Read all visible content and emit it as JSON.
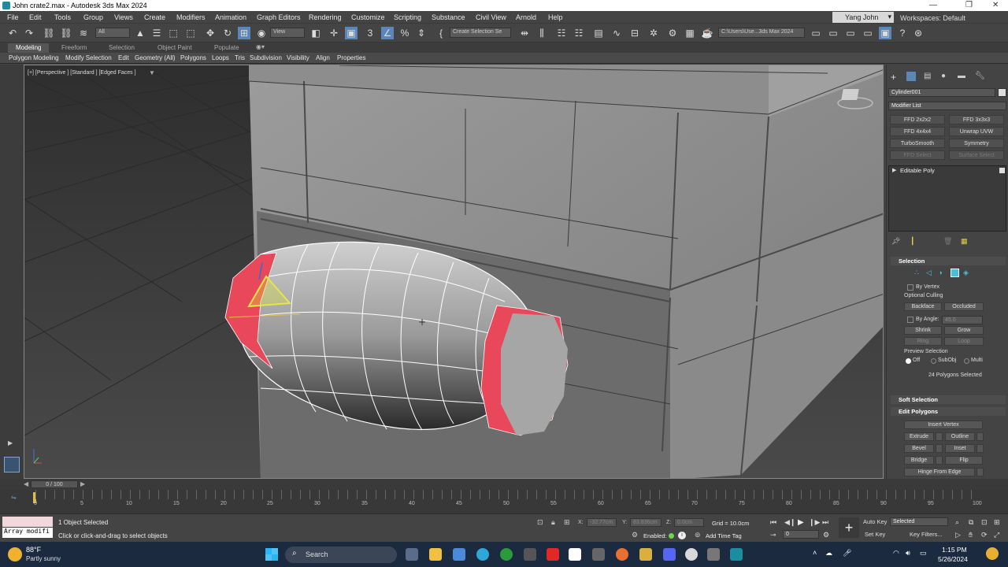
{
  "window": {
    "title": "John crate2.max - Autodesk 3ds Max 2024",
    "min": "—",
    "max": "❐",
    "close": "✕"
  },
  "menu": [
    "File",
    "Edit",
    "Tools",
    "Group",
    "Views",
    "Create",
    "Modifiers",
    "Animation",
    "Graph Editors",
    "Rendering",
    "Customize",
    "Scripting",
    "Substance",
    "Civil View",
    "Arnold",
    "Help"
  ],
  "user": "Yang John",
  "workspace": "Workspaces: Default",
  "toolbar": {
    "filter": "All",
    "view": "View",
    "selection_set": "Create Selection Se",
    "path": "C:\\Users\\Use...3ds Max 2024"
  },
  "ribbon_tabs": [
    "Modeling",
    "Freeform",
    "Selection",
    "Object Paint",
    "Populate"
  ],
  "ribbon_items": [
    "Polygon Modeling",
    "Modify Selection",
    "Edit",
    "Geometry (All)",
    "Polygons",
    "Loops",
    "Tris",
    "Subdivision",
    "Visibility",
    "Align",
    "Properties"
  ],
  "viewport": {
    "label": "[+] [Perspective ] [Standard ] [Edged Faces ]"
  },
  "cmd": {
    "object_name": "Cylinder001",
    "modifier_list": "Modifier List",
    "mod_buttons": [
      "FFD 2x2x2",
      "FFD 3x3x3",
      "FFD 4x4x4",
      "Unwrap UVW",
      "TurboSmooth",
      "Symmetry",
      "FFD Select",
      "Surface Select"
    ],
    "stack_item": "Editable Poly",
    "selection_title": "Selection",
    "by_vertex": "By Vertex",
    "optional_culling": "Optional Culling",
    "backface": "Backface",
    "occluded": "Occluded",
    "by_angle": "By Angle:",
    "angle_value": "45.0",
    "shrink": "Shrink",
    "grow": "Grow",
    "ring": "Ring",
    "loop": "Loop",
    "preview_selection": "Preview Selection",
    "preview_opts": [
      "Off",
      "SubObj",
      "Multi"
    ],
    "selected_info": "24 Polygons Selected",
    "soft_selection": "Soft Selection",
    "edit_polygons": "Edit Polygons",
    "insert_vertex": "Insert Vertex",
    "ep_buttons": [
      "Extrude",
      "Outline",
      "Bevel",
      "Inset",
      "Bridge",
      "Flip"
    ],
    "hinge": "Hinge From Edge"
  },
  "timeslider": "0 / 100",
  "ticks": [
    "0",
    "5",
    "10",
    "15",
    "20",
    "25",
    "30",
    "35",
    "40",
    "45",
    "50",
    "55",
    "60",
    "65",
    "70",
    "75",
    "80",
    "85",
    "90",
    "95",
    "100"
  ],
  "status": {
    "script": "Array modifi",
    "selected": "1 Object Selected",
    "prompt": "Click or click-and-drag to select objects",
    "x_label": "X:",
    "x": "-32.77cm",
    "y_label": "Y:",
    "y": "83.836cm",
    "z_label": "Z:",
    "z": "0.0cm",
    "grid": "Grid = 10.0cm",
    "enabled": "Enabled:",
    "add_time_tag": "Add Time Tag",
    "frame": "0",
    "auto_key": "Auto Key",
    "set_key": "Set Key",
    "selected_dd": "Selected",
    "key_filters": "Key Filters..."
  },
  "taskbar": {
    "temp": "88°F",
    "weather": "Partly sunny",
    "search": "Search",
    "time": "1:15 PM",
    "date": "5/26/2024"
  }
}
